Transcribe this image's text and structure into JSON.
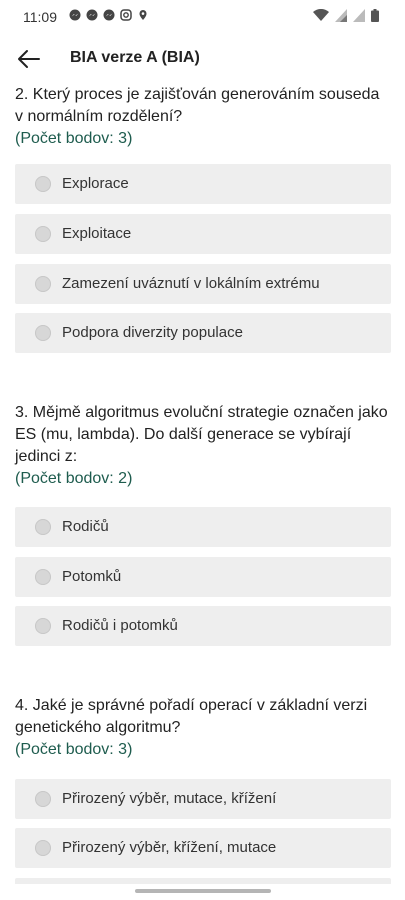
{
  "status": {
    "time": "11:09"
  },
  "appbar": {
    "title": "BIA verze A (BIA)"
  },
  "questions": [
    {
      "text": "2. Který proces je zajišťován generováním souseda v normálním rozdělení?",
      "points": "(Počet bodov: 3)",
      "options": [
        "Explorace",
        "Exploitace",
        "Zamezení uváznutí v lokálním extrému",
        "Podpora diverzity populace"
      ]
    },
    {
      "text": "3. Mějmě algoritmus evoluční strategie označen jako ES (mu, lambda). Do další generace se vybírají jedinci z:",
      "points": "(Počet bodov: 2)",
      "options": [
        "Rodičů",
        "Potomků",
        "Rodičů i potomků"
      ]
    },
    {
      "text": "4. Jaké je správné pořadí operací v základní verzi genetického algoritmu?",
      "points": "(Počet bodov: 3)",
      "options": [
        "Přirozený výběr, mutace, křížení",
        "Přirozený výběr, křížení, mutace"
      ]
    }
  ]
}
